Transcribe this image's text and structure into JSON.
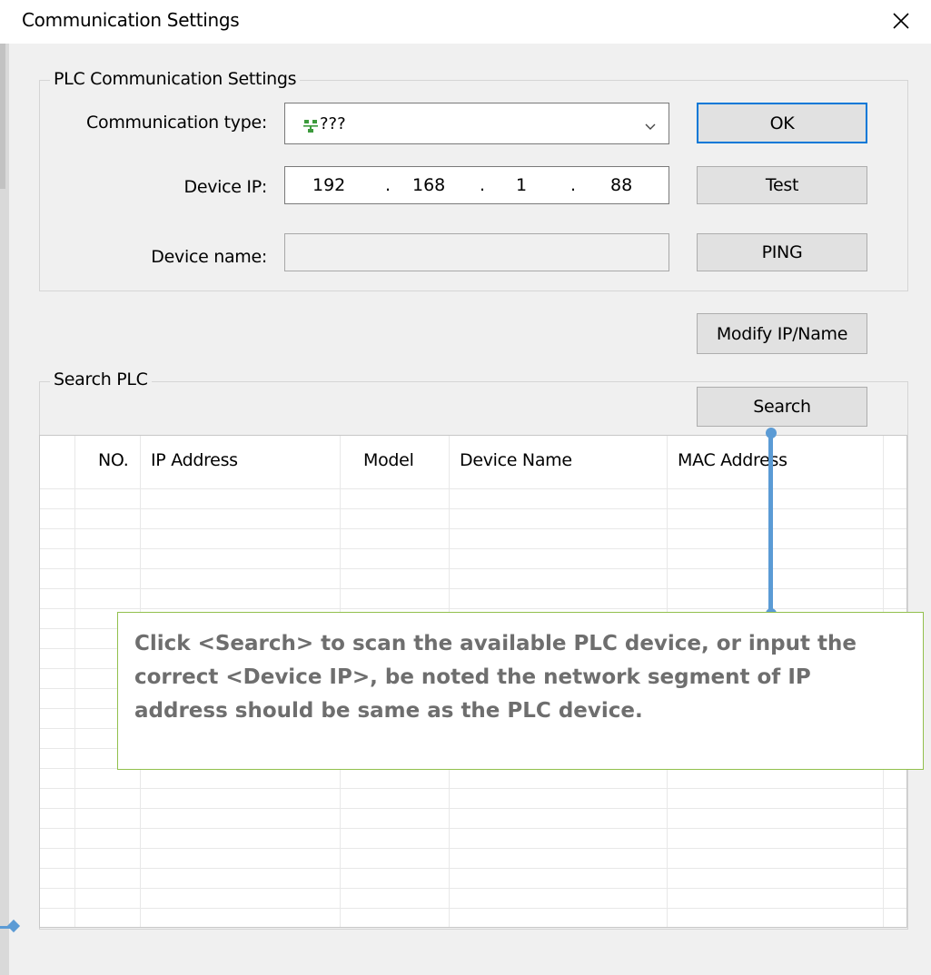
{
  "window": {
    "title": "Communication Settings",
    "close_icon": "close-icon"
  },
  "plc_settings": {
    "legend": "PLC Communication Settings",
    "comm_type_label": "Communication type:",
    "comm_type_value": "???",
    "comm_type_icon": "network-icon",
    "device_ip_label": "Device IP:",
    "ip": [
      "192",
      "168",
      "1",
      "88"
    ],
    "ip_separator": ".",
    "device_name_label": "Device name:",
    "device_name_value": ""
  },
  "buttons": {
    "ok": "OK",
    "test": "Test",
    "ping": "PING",
    "modify": "Modify IP/Name",
    "search": "Search"
  },
  "search_plc": {
    "legend": "Search PLC",
    "columns": [
      "NO.",
      "IP Address",
      "Model",
      "Device Name",
      "MAC Address"
    ]
  },
  "callout": {
    "text": "Click <Search> to scan the available PLC device, or input the correct <Device IP>, be noted the network segment of IP address should be same as the PLC device."
  },
  "colors": {
    "accent": "#0078d7",
    "annotation": "#5b9bd5",
    "callout_border": "#92c04d"
  }
}
